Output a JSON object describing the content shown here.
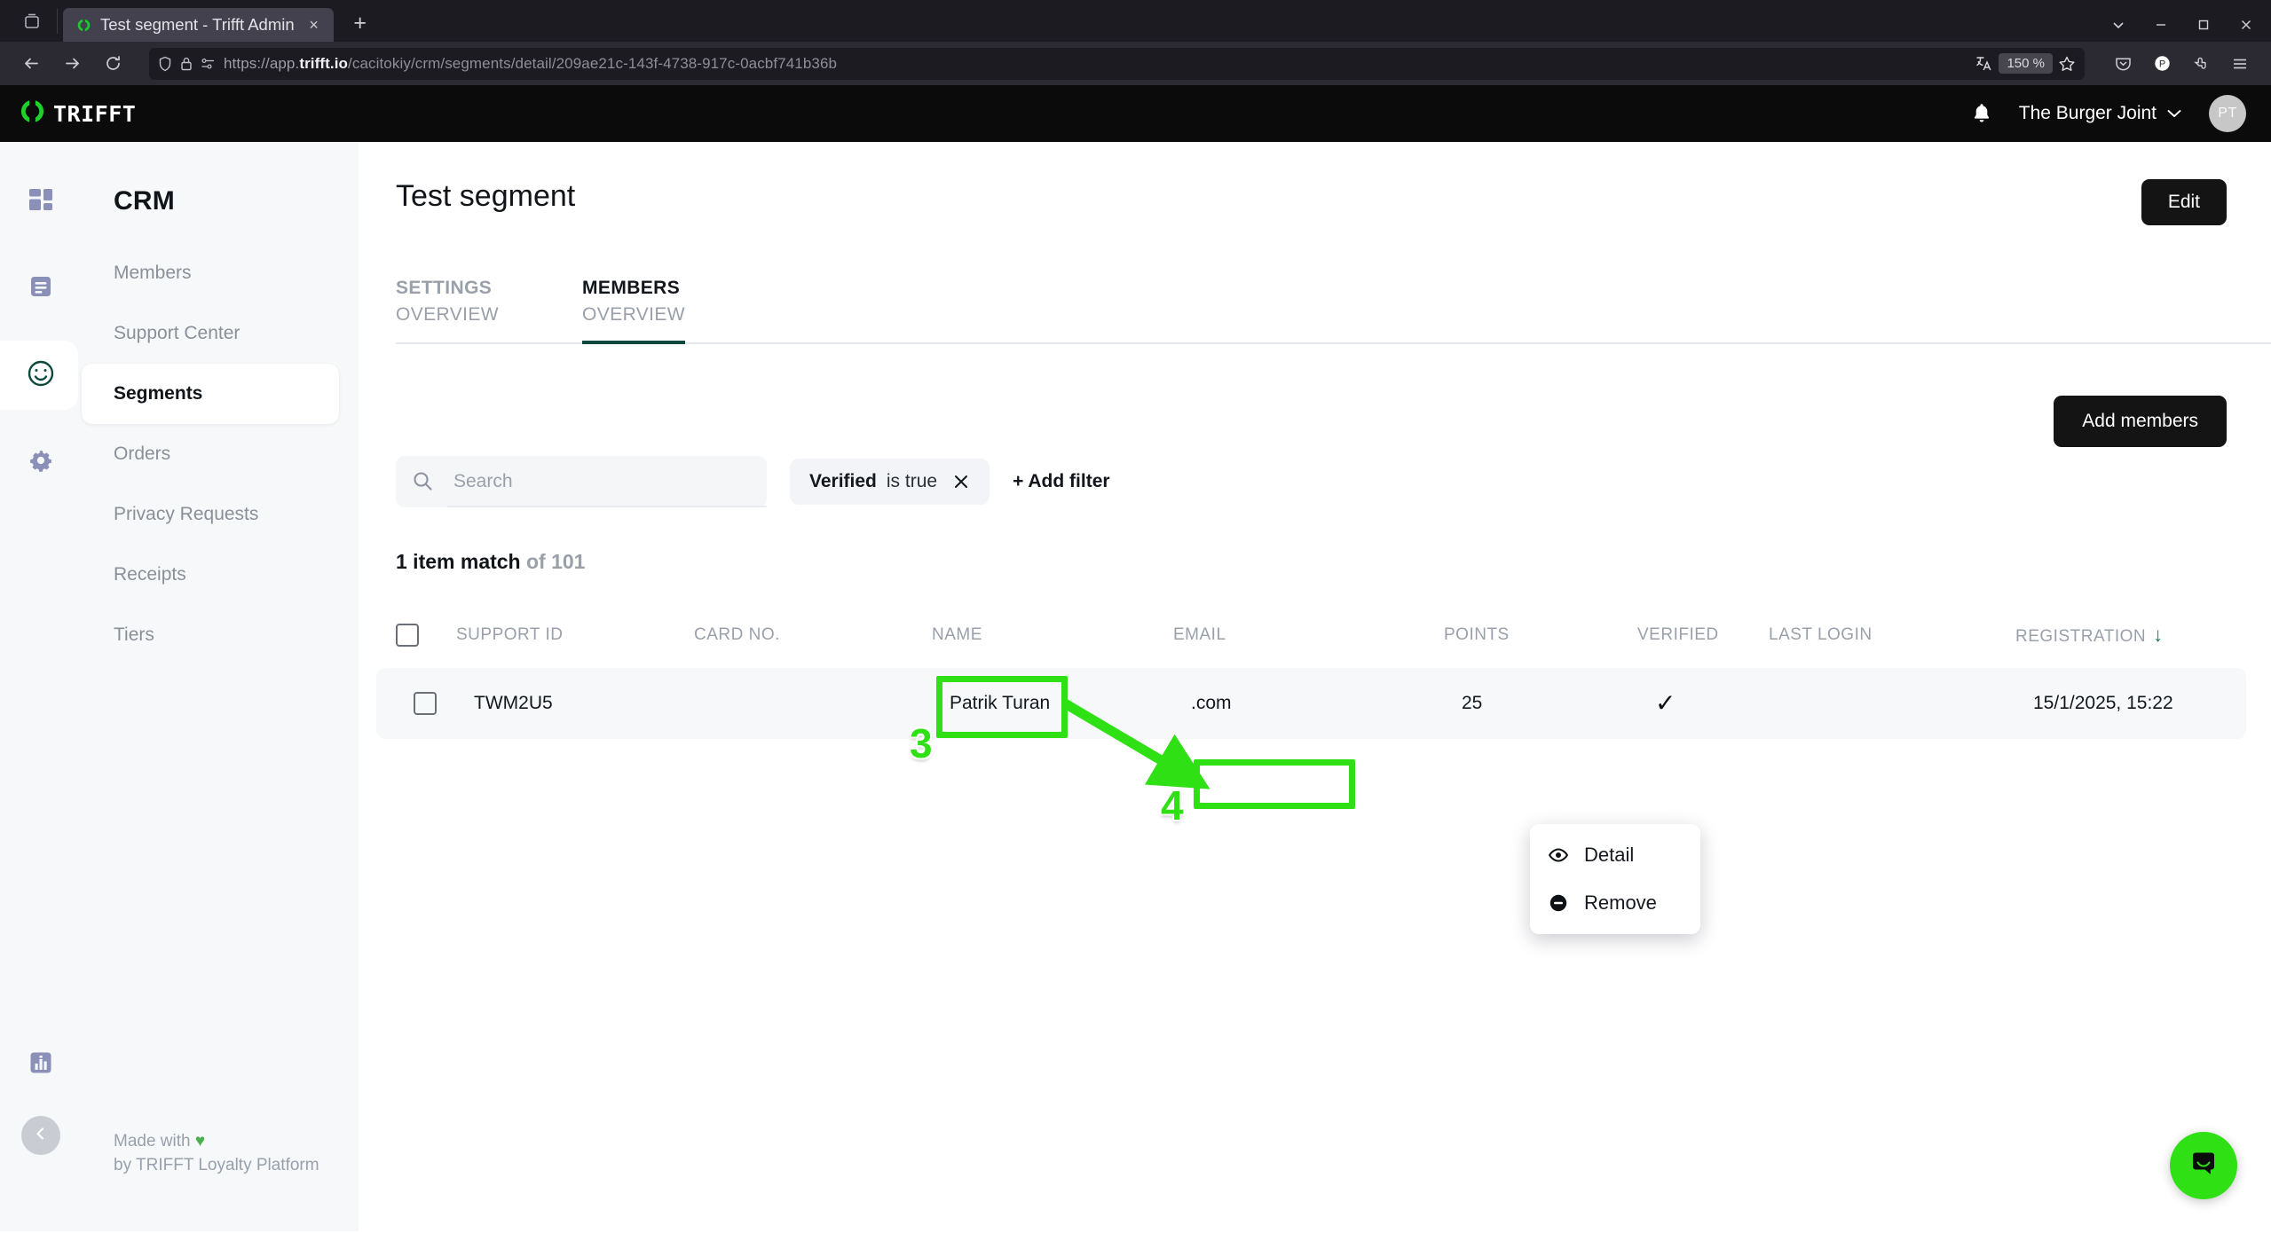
{
  "browser": {
    "tab": {
      "title": "Test segment - Trifft Admin",
      "favicon": "trifft-logo-icon",
      "close": "×"
    },
    "newtab_label": "+",
    "url": {
      "scheme": "https://app.",
      "domain": "trifft.io",
      "path": "/cacitokiy/crm/segments/detail/209ae21c-143f-4738-917c-0acbf741b36b"
    },
    "zoom_badge": "150 %",
    "icons": {
      "back": "back-arrow-icon",
      "forward": "forward-arrow-icon",
      "reload": "reload-icon",
      "shield": "shield-icon",
      "lock": "lock-icon",
      "permissions": "permissions-icon",
      "translate": "translate-icon",
      "bookmark": "star-icon",
      "pocket": "pocket-icon",
      "profile": "profile-icon",
      "extensions": "extensions-icon",
      "menu": "hamburger-menu-icon",
      "minimize": "minimize-icon",
      "maximize": "maximize-icon",
      "close": "window-close-icon",
      "list_all_tabs": "list-all-tabs-icon",
      "firefox_view": "firefox-view-icon"
    }
  },
  "appbar": {
    "logo_text": "TRIFFT",
    "org_name": "The Burger Joint",
    "avatar_initials": "PT"
  },
  "sidebar": {
    "section_title": "CRM",
    "items": [
      {
        "label": "Members",
        "active": false
      },
      {
        "label": "Support Center",
        "active": false
      },
      {
        "label": "Segments",
        "active": true
      },
      {
        "label": "Orders",
        "active": false
      },
      {
        "label": "Privacy Requests",
        "active": false
      },
      {
        "label": "Receipts",
        "active": false
      },
      {
        "label": "Tiers",
        "active": false
      }
    ],
    "footer_line1": "Made with ",
    "footer_heart": "♥",
    "footer_line2": "by TRIFFT Loyalty Platform"
  },
  "page": {
    "title": "Test segment",
    "edit_button": "Edit",
    "add_members_button": "Add members",
    "tabs": [
      {
        "line1": "SETTINGS",
        "line2": "OVERVIEW",
        "active": false
      },
      {
        "line1": "MEMBERS",
        "line2": "OVERVIEW",
        "active": true
      }
    ]
  },
  "filters": {
    "search_placeholder": "Search",
    "search_value": "",
    "chip": {
      "field": "Verified",
      "operator": "is true",
      "remove": "✕"
    },
    "add_filter": "+ Add filter"
  },
  "results": {
    "match_count": "1 item match",
    "total": "of 101"
  },
  "table": {
    "columns": [
      "SUPPORT ID",
      "CARD NO.",
      "NAME",
      "EMAIL",
      "POINTS",
      "VERIFIED",
      "LAST LOGIN",
      "REGISTRATION"
    ],
    "sorted_column": "REGISTRATION",
    "sort_direction": "↓",
    "rows": [
      {
        "support_id": "TWM2U5",
        "card_no": "",
        "name": "Patrik Turan",
        "email": ".com",
        "points": "25",
        "verified": "✓",
        "last_login": "",
        "registration": "15/1/2025, 15:22"
      }
    ]
  },
  "context_menu": {
    "items": [
      {
        "label": "Detail",
        "icon": "eye-icon"
      },
      {
        "label": "Remove",
        "icon": "minus-circle-icon"
      }
    ]
  },
  "annotations": {
    "accent_color": "#2ee014",
    "steps": [
      {
        "number": "3",
        "target": "name-cell"
      },
      {
        "number": "4",
        "target": "remove-menu-item"
      }
    ]
  },
  "support_widget": {
    "icon": "intercom-chat-icon",
    "color": "#2ee014"
  }
}
